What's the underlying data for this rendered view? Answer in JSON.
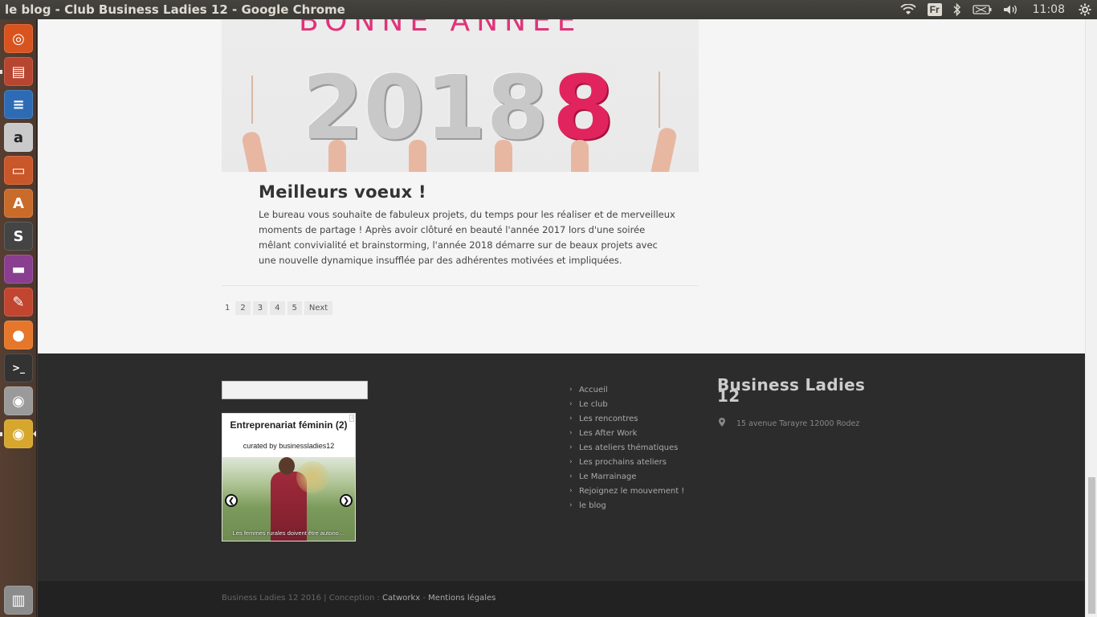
{
  "window": {
    "title": "le blog - Club Business Ladies 12 - Google Chrome"
  },
  "panel": {
    "keyboard_layout": "Fr",
    "clock": "11:08",
    "icons": [
      "wifi-icon",
      "bluetooth-icon",
      "battery-icon",
      "volume-icon",
      "settings-gear-icon"
    ]
  },
  "launcher": {
    "items": [
      {
        "name": "ubuntu-dash-icon",
        "color": "#d9531e"
      },
      {
        "name": "files-icon",
        "color": "#b8452f"
      },
      {
        "name": "libreoffice-writer-icon",
        "color": "#2d6bb5"
      },
      {
        "name": "amazon-icon",
        "color": "#c9c9c9"
      },
      {
        "name": "libreoffice-impress-icon",
        "color": "#c9572a"
      },
      {
        "name": "software-center-icon",
        "color": "#c96b2a"
      },
      {
        "name": "sublime-text-icon",
        "color": "#444444"
      },
      {
        "name": "app-window-icon",
        "color": "#8a3e8f"
      },
      {
        "name": "system-settings-icon",
        "color": "#c2452f"
      },
      {
        "name": "firefox-icon",
        "color": "#e6762a"
      },
      {
        "name": "terminal-icon",
        "color": "#333333"
      },
      {
        "name": "camera-icon",
        "color": "#9a9a9a"
      },
      {
        "name": "chrome-icon",
        "color": "#d6a72c"
      },
      {
        "name": "trash-icon",
        "color": "#8c8c8c"
      }
    ]
  },
  "hero": {
    "year": "2018",
    "top_words": "BONNE ANNEE"
  },
  "post": {
    "title": "Meilleurs voeux !",
    "excerpt": "Le bureau vous souhaite de fabuleux projets, du temps pour les réaliser et de merveilleux moments de partage ! Après avoir clôturé en beauté l'année 2017 lors d'une soirée mêlant convivialité et brainstorming, l'année 2018 démarre sur de beaux projets avec une nouvelle dynamique insufflée par des adhérentes motivées et impliquées."
  },
  "pagination": {
    "pages": [
      "1",
      "2",
      "3",
      "4",
      "5"
    ],
    "current": "1",
    "next": "Next"
  },
  "footer": {
    "search_placeholder": "",
    "scoop": {
      "title": "Entreprenariat féminin (2)",
      "curated_by": "curated by businessladies12",
      "ad_label": "i",
      "caption": "Les femmes rurales doivent être autono…"
    },
    "menu": [
      "Accueil",
      "Le club",
      "Les rencontres",
      "Les After Work",
      "Les ateliers thématiques",
      "Les prochains ateliers",
      "Le Marrainage",
      "Rejoignez le mouvement !",
      "le blog"
    ],
    "brand": "Business Ladies 12",
    "address": "15 avenue Tarayre 12000 Rodez"
  },
  "bottom": {
    "copyright_prefix": "Business Ladies 12  2016 | Conception : ",
    "agency": "Catworkx",
    "separator": " - ",
    "legal": "Mentions légales"
  }
}
